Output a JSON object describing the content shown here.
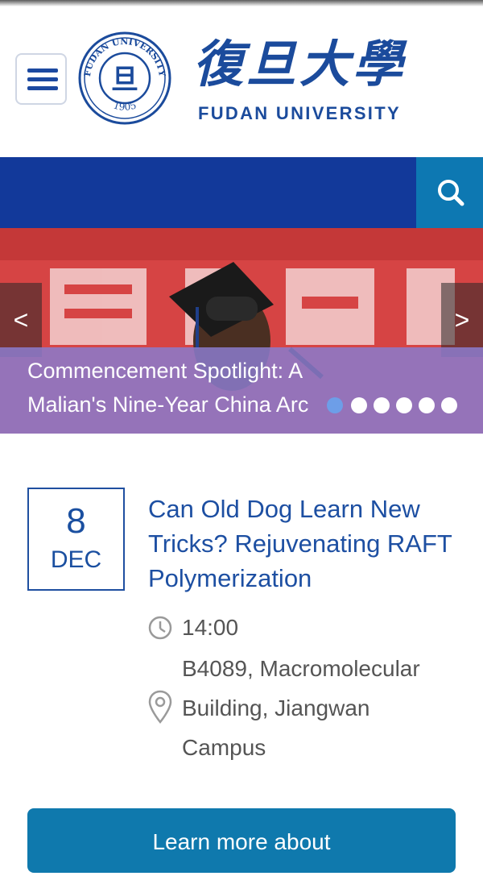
{
  "header": {
    "seal_text_top": "FUDAN UNIVERSITY",
    "seal_year": "1905",
    "seal_center": "旦",
    "name_cn": "復旦大學",
    "name_en": "FUDAN UNIVERSITY"
  },
  "carousel": {
    "caption": "Commencement Spotlight: A Malian's Nine-Year China Arc",
    "prev_label": "<",
    "next_label": ">",
    "slide_count": 6,
    "active_slide": 1
  },
  "event": {
    "day": "8",
    "month": "DEC",
    "title": "Can Old Dog Learn New Tricks? Rejuvenating RAFT Polymerization",
    "time": "14:00",
    "location": "B4089, Macromolecular Building, Jiangwan Campus"
  },
  "cta": {
    "label": "Learn more about"
  },
  "colors": {
    "brand_blue": "#12399a",
    "search_blue": "#0d78b2",
    "caption_purple": "#8b7bcd",
    "button_blue": "#0f79ad"
  },
  "icons": [
    "menu-icon",
    "search-icon",
    "clock-icon",
    "location-pin-icon"
  ]
}
